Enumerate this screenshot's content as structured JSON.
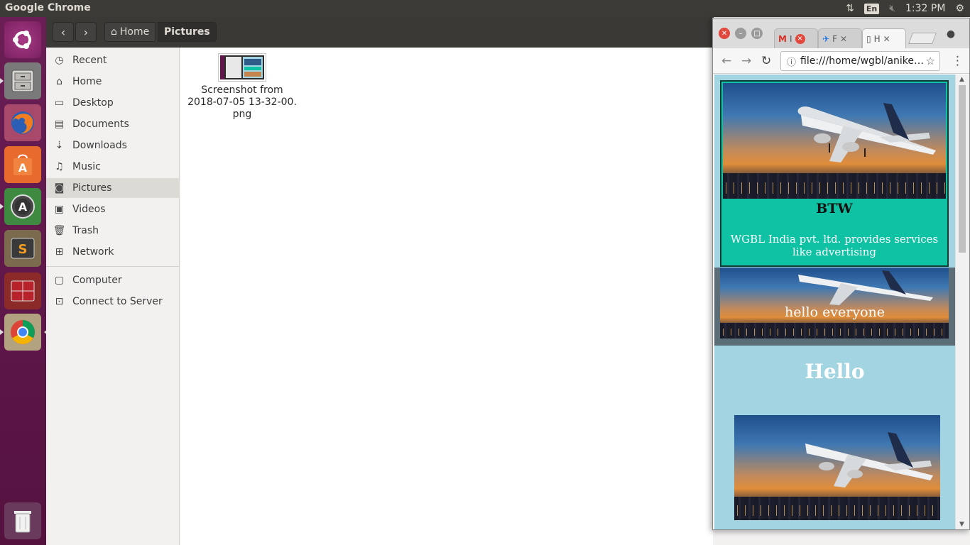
{
  "top_panel": {
    "app_title": "Google Chrome",
    "lang": "En",
    "clock": "1:32 PM"
  },
  "launcher": {
    "items": [
      "ubuntu-dash",
      "files",
      "firefox",
      "software-center",
      "software-updater",
      "sublime-text",
      "terminal-app",
      "chrome",
      "trash"
    ]
  },
  "file_manager": {
    "breadcrumb": {
      "home": "Home",
      "current": "Pictures"
    },
    "sidebar": {
      "items": [
        {
          "label": "Recent",
          "icon": "clock-icon"
        },
        {
          "label": "Home",
          "icon": "home-icon"
        },
        {
          "label": "Desktop",
          "icon": "folder-icon"
        },
        {
          "label": "Documents",
          "icon": "document-icon"
        },
        {
          "label": "Downloads",
          "icon": "download-icon"
        },
        {
          "label": "Music",
          "icon": "music-icon"
        },
        {
          "label": "Pictures",
          "icon": "camera-icon",
          "active": true
        },
        {
          "label": "Videos",
          "icon": "video-icon"
        },
        {
          "label": "Trash",
          "icon": "trash-icon"
        },
        {
          "label": "Network",
          "icon": "network-icon"
        },
        {
          "label": "Computer",
          "icon": "computer-icon"
        },
        {
          "label": "Connect to Server",
          "icon": "server-icon"
        }
      ]
    },
    "files": [
      {
        "name_line1": "Screenshot from",
        "name_line2": "2018-07-05 13-32-00.",
        "name_line3": "png"
      }
    ]
  },
  "chrome": {
    "tabs": [
      {
        "label": "M I"
      },
      {
        "label": "F"
      },
      {
        "label": "H",
        "active": true
      }
    ],
    "address": "file:///home/wgbl/anike…",
    "page": {
      "card_title": "BTW",
      "card_text": "WGBL India pvt. ltd. provides services like advertising",
      "banner_text": "hello everyone",
      "heading": "Hello"
    }
  },
  "colors": {
    "launcher_bg": "#5e1748",
    "panel_bg": "#3c3b37",
    "page_bg": "#a2d4e1",
    "card_bg": "#10c2a4",
    "banner_bg": "#5b6e77"
  }
}
